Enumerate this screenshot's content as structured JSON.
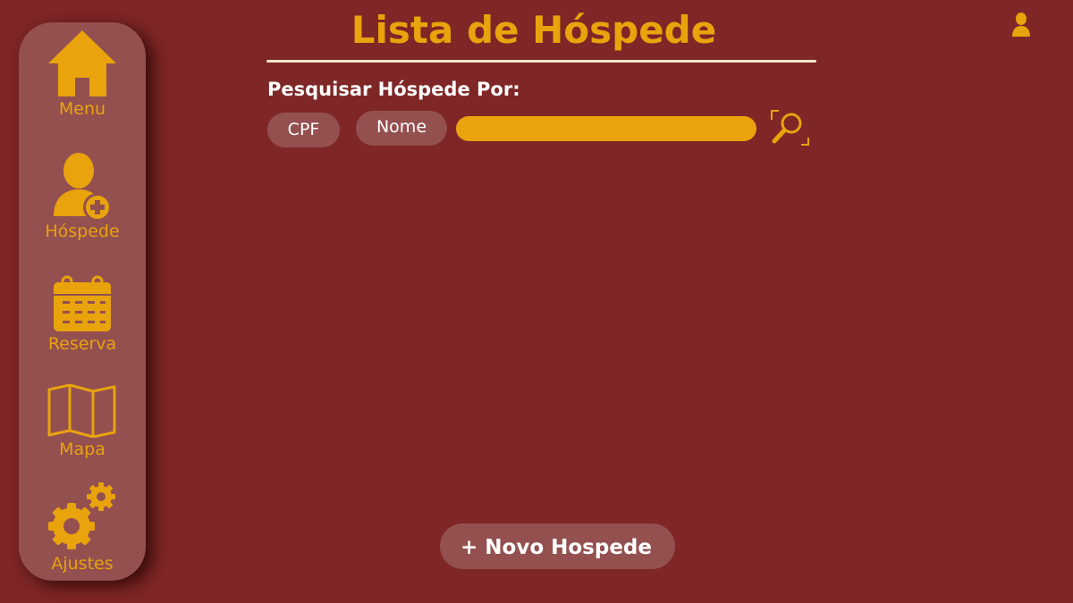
{
  "header": {
    "title": "Lista de Hóspede"
  },
  "user": {
    "icon": "user-icon"
  },
  "sidebar": {
    "items": [
      {
        "label": "Menu",
        "icon": "home-icon"
      },
      {
        "label": "Hóspede",
        "icon": "add-user-icon"
      },
      {
        "label": "Reserva",
        "icon": "calendar-icon"
      },
      {
        "label": "Mapa",
        "icon": "map-icon"
      },
      {
        "label": "Ajustes",
        "icon": "gears-icon"
      }
    ]
  },
  "search": {
    "label": "Pesquisar Hóspede Por:",
    "options": [
      "CPF",
      "Nome"
    ],
    "value": "",
    "icon": "search-icon"
  },
  "actions": {
    "new_guest": "+ Novo Hospede"
  },
  "colors": {
    "background": "#7f2626",
    "panel": "#94504f",
    "accent": "#e8a30d",
    "text": "#ffffff",
    "rule": "#f3e4c8"
  }
}
